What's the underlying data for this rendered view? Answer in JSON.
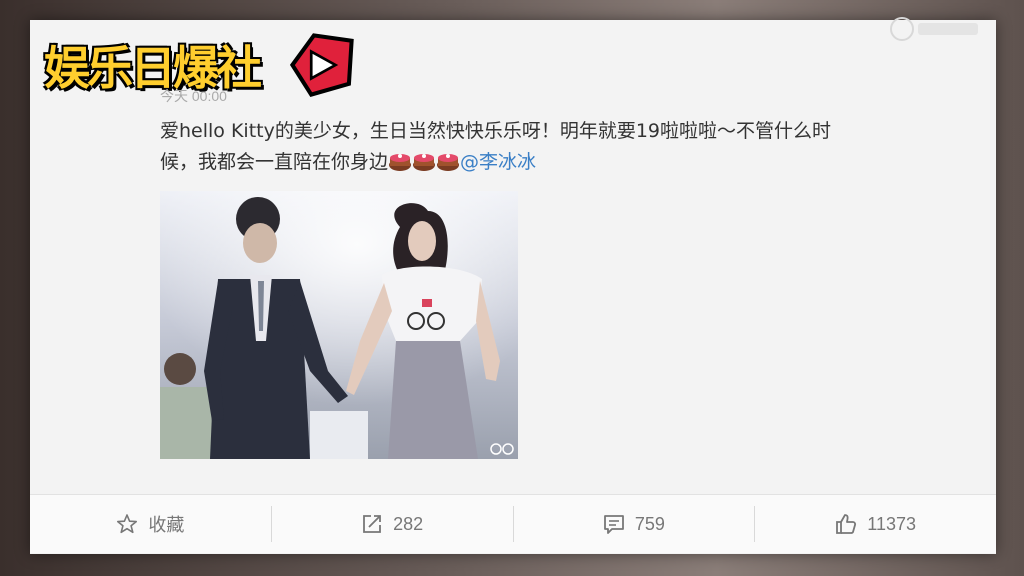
{
  "brand": {
    "logo_text": "娱乐日爆社"
  },
  "post": {
    "timestamp": "今天 00:00",
    "line1": "爱hello Kitty的美少女，生日当然快快乐乐呀！明年就要19啦啦啦～不管什么时",
    "line2": "候，我都会一直陪在你身边",
    "mention": "@李冰冰"
  },
  "actions": {
    "favorite_label": "收藏",
    "repost_count": "282",
    "comment_count": "759",
    "like_count": "11373"
  },
  "icons": {
    "favorite": "star-icon",
    "repost": "repost-icon",
    "comment": "comment-icon",
    "like": "thumbs-up-icon",
    "cake": "cake-emoji-icon"
  },
  "colors": {
    "mention": "#3a7fc6",
    "logo": "#ffce2e",
    "badge": "#e0213b"
  }
}
